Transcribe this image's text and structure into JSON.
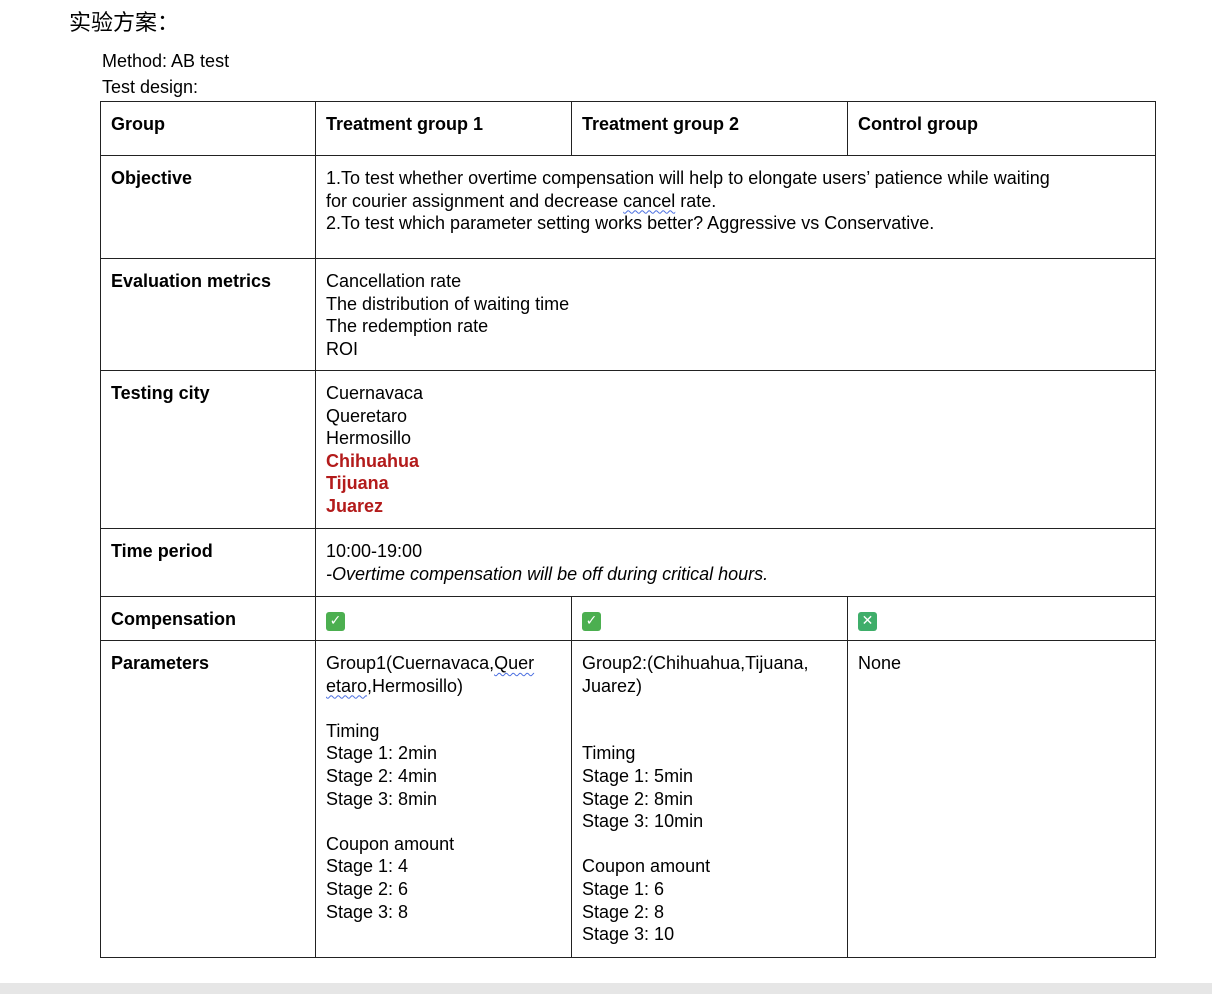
{
  "heading": "实验方案：",
  "method_line": "Method: AB test",
  "design_line": "Test design:",
  "colors": {
    "highlight_city": "#b31b1b",
    "check": "#4caf50"
  },
  "table": {
    "header": [
      "Group",
      "Treatment group 1",
      "Treatment group 2",
      "Control group"
    ],
    "objective": {
      "label": "Objective",
      "line1a": "1.To test whether overtime compensation will help to elongate users’ patience while waiting",
      "line1b_pre": "for courier assignment and decrease ",
      "line1b_sq": "cancel",
      "line1b_post": " rate.",
      "line2": "2.To test which parameter setting works better? Aggressive vs Conservative."
    },
    "metrics": {
      "label": "Evaluation metrics",
      "items": [
        "Cancellation rate",
        "The distribution of waiting time",
        "The redemption rate",
        "ROI"
      ]
    },
    "city": {
      "label": "Testing city",
      "plain": [
        "Cuernavaca",
        "Queretaro",
        "Hermosillo"
      ],
      "highlighted": [
        "Chihuahua",
        "Tijuana",
        "Juarez"
      ]
    },
    "time": {
      "label": "Time period",
      "range": "10:00-19:00",
      "note": "-Overtime compensation will be off during critical hours."
    },
    "compensation": {
      "label": "Compensation",
      "g1": {
        "icon": "check-mark-icon",
        "glyph": "✓"
      },
      "g2": {
        "icon": "check-mark-icon",
        "glyph": "✓"
      },
      "control": {
        "icon": "cross-mark-icon",
        "glyph": "✕"
      }
    },
    "parameters": {
      "label": "Parameters",
      "g1": {
        "line1_pre": "Group1(Cuernavaca,",
        "line1_sq": "Quer",
        "line2_sq": "etaro",
        "line2_post": ",Hermosillo)",
        "timing_title": "Timing",
        "timing": [
          "Stage 1: 2min",
          "Stage 2: 4min",
          "Stage 3: 8min"
        ],
        "coupon_title": "Coupon amount",
        "coupon": [
          "Stage 1: 4",
          "Stage 2: 6",
          "Stage 3: 8"
        ]
      },
      "g2": {
        "line1": "Group2:(Chihuahua,Tijuana,",
        "line2": "Juarez)",
        "timing_title": "Timing",
        "timing": [
          "Stage 1: 5min",
          "Stage 2: 8min",
          "Stage 3: 10min"
        ],
        "coupon_title": "Coupon amount",
        "coupon": [
          "Stage 1: 6",
          "Stage 2: 8",
          "Stage 3: 10"
        ]
      },
      "control": "None"
    }
  }
}
